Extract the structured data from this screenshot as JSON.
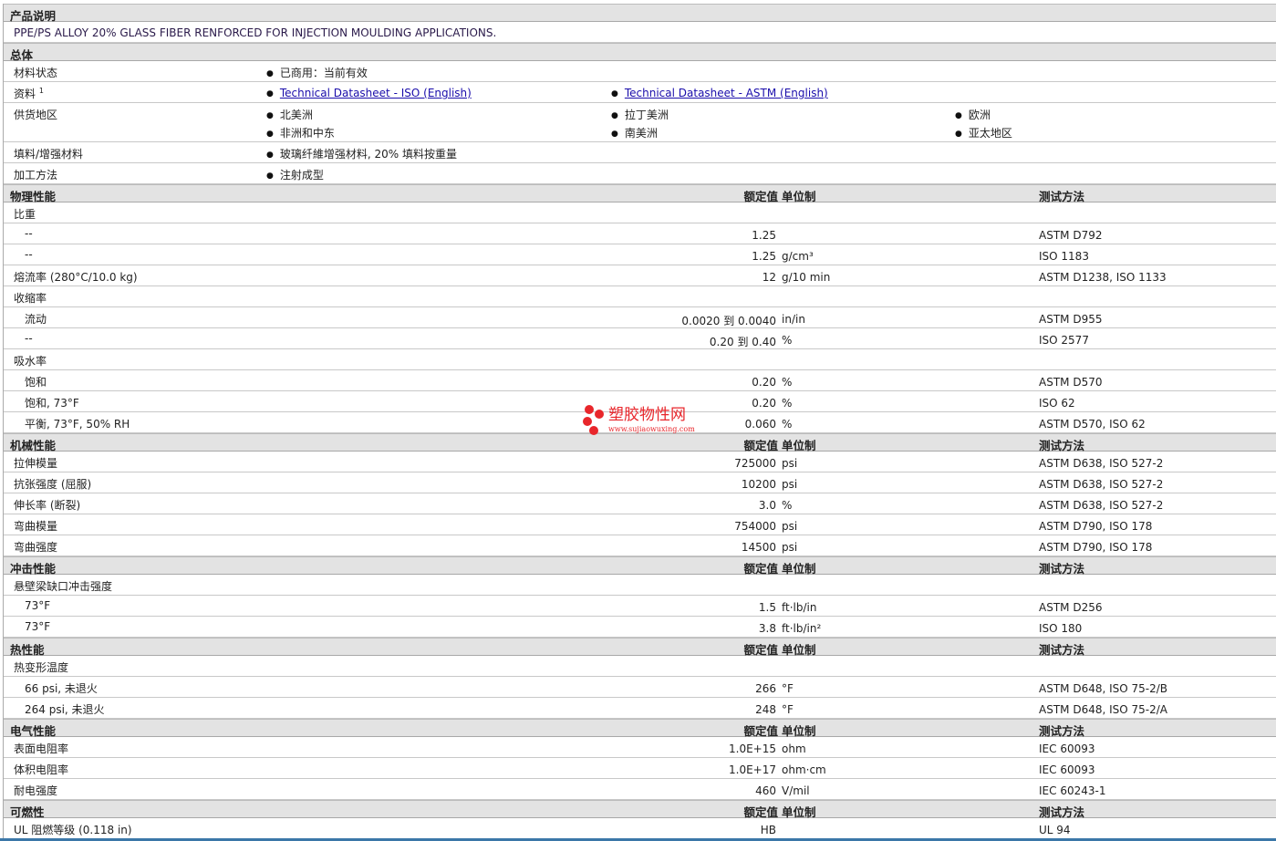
{
  "description_header": "产品说明",
  "description": "PPE/PS ALLOY 20% GLASS FIBER RENFORCED FOR INJECTION MOULDING APPLICATIONS.",
  "general": {
    "header": "总体",
    "rows": [
      {
        "label": "材料状态",
        "items": [
          "已商用：当前有效"
        ]
      },
      {
        "label": "资料",
        "sup": "1",
        "links": [
          "Technical Datasheet - ISO (English)",
          "Technical Datasheet - ASTM (English)"
        ]
      },
      {
        "label": "供货地区",
        "items": [
          "北美洲",
          "拉丁美洲",
          "欧洲",
          "非洲和中东",
          "南美洲",
          "亚太地区"
        ]
      },
      {
        "label": "填料/增强材料",
        "items": [
          "玻璃纤維增强材料, 20% 填料按重量"
        ]
      },
      {
        "label": "加工方法",
        "items": [
          "注射成型"
        ]
      }
    ]
  },
  "column_headers": {
    "value": "额定值",
    "unit": "单位制",
    "method": "测试方法"
  },
  "sections": [
    {
      "header": "物理性能",
      "show_cols": true,
      "rows": [
        {
          "label": "比重",
          "group": true
        },
        {
          "label": "--",
          "sub": true,
          "value": "1.25",
          "unit": "",
          "method": "ASTM D792"
        },
        {
          "label": "--",
          "sub": true,
          "value": "1.25",
          "unit": "g/cm³",
          "method": "ISO 1183"
        },
        {
          "label": "熔流率 (280°C/10.0 kg)",
          "value": "12",
          "unit": "g/10 min",
          "method": "ASTM D1238, ISO 1133"
        },
        {
          "label": "收缩率",
          "group": true
        },
        {
          "label": "流动",
          "sub": true,
          "value": "0.0020 到 0.0040",
          "unit": "in/in",
          "method": "ASTM D955"
        },
        {
          "label": "--",
          "sub": true,
          "value": "0.20 到 0.40",
          "unit": "%",
          "method": "ISO 2577"
        },
        {
          "label": "吸水率",
          "group": true
        },
        {
          "label": "饱和",
          "sub": true,
          "value": "0.20",
          "unit": "%",
          "method": "ASTM D570"
        },
        {
          "label": "饱和, 73°F",
          "sub": true,
          "value": "0.20",
          "unit": "%",
          "method": "ISO 62"
        },
        {
          "label": "平衡, 73°F, 50% RH",
          "sub": true,
          "value": "0.060",
          "unit": "%",
          "method": "ASTM D570, ISO 62"
        }
      ]
    },
    {
      "header": "机械性能",
      "rows": [
        {
          "label": "拉伸模量",
          "value": "725000",
          "unit": "psi",
          "method": "ASTM D638, ISO 527-2"
        },
        {
          "label": "抗张强度 (屈服)",
          "value": "10200",
          "unit": "psi",
          "method": "ASTM D638, ISO 527-2"
        },
        {
          "label": "伸长率 (断裂)",
          "value": "3.0",
          "unit": "%",
          "method": "ASTM D638, ISO 527-2"
        },
        {
          "label": "弯曲模量",
          "value": "754000",
          "unit": "psi",
          "method": "ASTM D790, ISO 178"
        },
        {
          "label": "弯曲强度",
          "value": "14500",
          "unit": "psi",
          "method": "ASTM D790, ISO 178"
        }
      ]
    },
    {
      "header": "冲击性能",
      "rows": [
        {
          "label": "悬壁梁缺口冲击强度",
          "group": true
        },
        {
          "label": "73°F",
          "sub": true,
          "value": "1.5",
          "unit": "ft·lb/in",
          "method": "ASTM D256"
        },
        {
          "label": "73°F",
          "sub": true,
          "value": "3.8",
          "unit": "ft·lb/in²",
          "method": "ISO 180"
        }
      ]
    },
    {
      "header": "热性能",
      "rows": [
        {
          "label": "热变形温度",
          "group": true
        },
        {
          "label": "66 psi, 未退火",
          "sub": true,
          "value": "266",
          "unit": "°F",
          "method": "ASTM D648, ISO 75-2/B"
        },
        {
          "label": "264 psi, 未退火",
          "sub": true,
          "value": "248",
          "unit": "°F",
          "method": "ASTM D648, ISO 75-2/A"
        }
      ]
    },
    {
      "header": "电气性能",
      "rows": [
        {
          "label": "表面电阻率",
          "value": "1.0E+15",
          "unit": "ohm",
          "method": "IEC 60093"
        },
        {
          "label": "体积电阻率",
          "value": "1.0E+17",
          "unit": "ohm·cm",
          "method": "IEC 60093"
        },
        {
          "label": "耐电强度",
          "value": "460",
          "unit": "V/mil",
          "method": "IEC 60243-1"
        }
      ]
    },
    {
      "header": "可燃性",
      "rows": [
        {
          "label": "UL 阻燃等级 (0.118 in)",
          "value": "HB",
          "unit": "",
          "method": "UL 94"
        }
      ]
    }
  ],
  "watermark": {
    "text": "塑胶物性网",
    "url": "www.sujiaowuxing.com",
    "color": "#e8262b"
  }
}
